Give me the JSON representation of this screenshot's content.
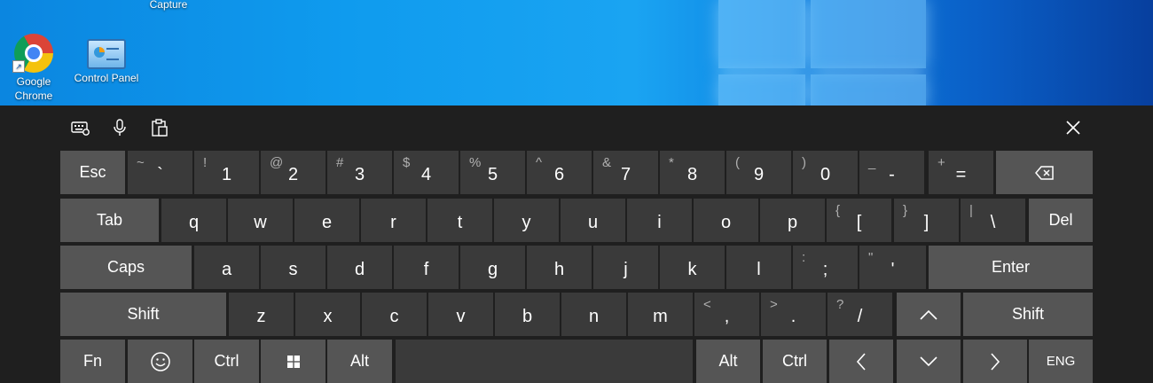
{
  "desktop": {
    "partial_icon_label": "Capture",
    "icons": [
      {
        "name": "Google Chrome",
        "line1": "Google",
        "line2": "Chrome"
      },
      {
        "name": "Control Panel",
        "line1": "Control Panel"
      }
    ]
  },
  "toolbar": {
    "settings_icon": "keyboard-settings-icon",
    "mic_icon": "microphone-icon",
    "clipboard_icon": "clipboard-icon",
    "close_icon": "close-icon"
  },
  "keys": {
    "esc": "Esc",
    "row1": [
      {
        "sec": "~",
        "pri": "`"
      },
      {
        "sec": "!",
        "pri": "1"
      },
      {
        "sec": "@",
        "pri": "2"
      },
      {
        "sec": "#",
        "pri": "3"
      },
      {
        "sec": "$",
        "pri": "4"
      },
      {
        "sec": "%",
        "pri": "5"
      },
      {
        "sec": "^",
        "pri": "6"
      },
      {
        "sec": "&",
        "pri": "7"
      },
      {
        "sec": "*",
        "pri": "8"
      },
      {
        "sec": "(",
        "pri": "9"
      },
      {
        "sec": ")",
        "pri": "0"
      },
      {
        "sec": "_",
        "pri": "-"
      },
      {
        "sec": "+",
        "pri": "="
      }
    ],
    "backspace_icon": "backspace-icon",
    "tab": "Tab",
    "row2": [
      {
        "pri": "q"
      },
      {
        "pri": "w"
      },
      {
        "pri": "e"
      },
      {
        "pri": "r"
      },
      {
        "pri": "t"
      },
      {
        "pri": "y"
      },
      {
        "pri": "u"
      },
      {
        "pri": "i"
      },
      {
        "pri": "o"
      },
      {
        "pri": "p"
      },
      {
        "sec": "{",
        "pri": "["
      },
      {
        "sec": "}",
        "pri": "]"
      },
      {
        "sec": "|",
        "pri": "\\"
      }
    ],
    "del": "Del",
    "caps": "Caps",
    "row3": [
      {
        "pri": "a"
      },
      {
        "pri": "s"
      },
      {
        "pri": "d"
      },
      {
        "pri": "f"
      },
      {
        "pri": "g"
      },
      {
        "pri": "h"
      },
      {
        "pri": "j"
      },
      {
        "pri": "k"
      },
      {
        "pri": "l"
      },
      {
        "sec": ":",
        "pri": ";"
      },
      {
        "sec": "\"",
        "pri": "'"
      }
    ],
    "enter": "Enter",
    "shift_left": "Shift",
    "row4": [
      {
        "pri": "z"
      },
      {
        "pri": "x"
      },
      {
        "pri": "c"
      },
      {
        "pri": "v"
      },
      {
        "pri": "b"
      },
      {
        "pri": "n"
      },
      {
        "pri": "m"
      },
      {
        "sec": "<",
        "pri": ","
      },
      {
        "sec": ">",
        "pri": "."
      },
      {
        "sec": "?",
        "pri": "/"
      }
    ],
    "up_icon": "up-arrow-icon",
    "shift_right": "Shift",
    "fn": "Fn",
    "emoji_icon": "emoji-icon",
    "ctrl_left": "Ctrl",
    "windows_icon": "windows-icon",
    "alt_left": "Alt",
    "space_label": "",
    "alt_right": "Alt",
    "ctrl_right": "Ctrl",
    "left_icon": "left-arrow-icon",
    "down_icon": "down-arrow-icon",
    "right_icon": "right-arrow-icon",
    "lang": "ENG"
  }
}
